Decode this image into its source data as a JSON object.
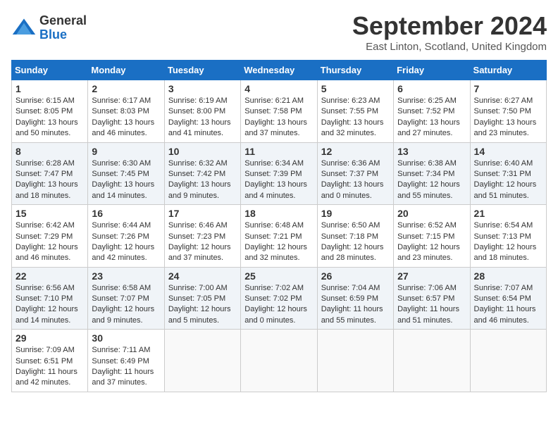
{
  "header": {
    "logo_general": "General",
    "logo_blue": "Blue",
    "title": "September 2024",
    "location": "East Linton, Scotland, United Kingdom"
  },
  "calendar": {
    "headers": [
      "Sunday",
      "Monday",
      "Tuesday",
      "Wednesday",
      "Thursday",
      "Friday",
      "Saturday"
    ],
    "weeks": [
      [
        {
          "day": "1",
          "sunrise": "6:15 AM",
          "sunset": "8:05 PM",
          "daylight": "13 hours and 50 minutes."
        },
        {
          "day": "2",
          "sunrise": "6:17 AM",
          "sunset": "8:03 PM",
          "daylight": "13 hours and 46 minutes."
        },
        {
          "day": "3",
          "sunrise": "6:19 AM",
          "sunset": "8:00 PM",
          "daylight": "13 hours and 41 minutes."
        },
        {
          "day": "4",
          "sunrise": "6:21 AM",
          "sunset": "7:58 PM",
          "daylight": "13 hours and 37 minutes."
        },
        {
          "day": "5",
          "sunrise": "6:23 AM",
          "sunset": "7:55 PM",
          "daylight": "13 hours and 32 minutes."
        },
        {
          "day": "6",
          "sunrise": "6:25 AM",
          "sunset": "7:52 PM",
          "daylight": "13 hours and 27 minutes."
        },
        {
          "day": "7",
          "sunrise": "6:27 AM",
          "sunset": "7:50 PM",
          "daylight": "13 hours and 23 minutes."
        }
      ],
      [
        {
          "day": "8",
          "sunrise": "6:28 AM",
          "sunset": "7:47 PM",
          "daylight": "13 hours and 18 minutes."
        },
        {
          "day": "9",
          "sunrise": "6:30 AM",
          "sunset": "7:45 PM",
          "daylight": "13 hours and 14 minutes."
        },
        {
          "day": "10",
          "sunrise": "6:32 AM",
          "sunset": "7:42 PM",
          "daylight": "13 hours and 9 minutes."
        },
        {
          "day": "11",
          "sunrise": "6:34 AM",
          "sunset": "7:39 PM",
          "daylight": "13 hours and 4 minutes."
        },
        {
          "day": "12",
          "sunrise": "6:36 AM",
          "sunset": "7:37 PM",
          "daylight": "13 hours and 0 minutes."
        },
        {
          "day": "13",
          "sunrise": "6:38 AM",
          "sunset": "7:34 PM",
          "daylight": "12 hours and 55 minutes."
        },
        {
          "day": "14",
          "sunrise": "6:40 AM",
          "sunset": "7:31 PM",
          "daylight": "12 hours and 51 minutes."
        }
      ],
      [
        {
          "day": "15",
          "sunrise": "6:42 AM",
          "sunset": "7:29 PM",
          "daylight": "12 hours and 46 minutes."
        },
        {
          "day": "16",
          "sunrise": "6:44 AM",
          "sunset": "7:26 PM",
          "daylight": "12 hours and 42 minutes."
        },
        {
          "day": "17",
          "sunrise": "6:46 AM",
          "sunset": "7:23 PM",
          "daylight": "12 hours and 37 minutes."
        },
        {
          "day": "18",
          "sunrise": "6:48 AM",
          "sunset": "7:21 PM",
          "daylight": "12 hours and 32 minutes."
        },
        {
          "day": "19",
          "sunrise": "6:50 AM",
          "sunset": "7:18 PM",
          "daylight": "12 hours and 28 minutes."
        },
        {
          "day": "20",
          "sunrise": "6:52 AM",
          "sunset": "7:15 PM",
          "daylight": "12 hours and 23 minutes."
        },
        {
          "day": "21",
          "sunrise": "6:54 AM",
          "sunset": "7:13 PM",
          "daylight": "12 hours and 18 minutes."
        }
      ],
      [
        {
          "day": "22",
          "sunrise": "6:56 AM",
          "sunset": "7:10 PM",
          "daylight": "12 hours and 14 minutes."
        },
        {
          "day": "23",
          "sunrise": "6:58 AM",
          "sunset": "7:07 PM",
          "daylight": "12 hours and 9 minutes."
        },
        {
          "day": "24",
          "sunrise": "7:00 AM",
          "sunset": "7:05 PM",
          "daylight": "12 hours and 5 minutes."
        },
        {
          "day": "25",
          "sunrise": "7:02 AM",
          "sunset": "7:02 PM",
          "daylight": "12 hours and 0 minutes."
        },
        {
          "day": "26",
          "sunrise": "7:04 AM",
          "sunset": "6:59 PM",
          "daylight": "11 hours and 55 minutes."
        },
        {
          "day": "27",
          "sunrise": "7:06 AM",
          "sunset": "6:57 PM",
          "daylight": "11 hours and 51 minutes."
        },
        {
          "day": "28",
          "sunrise": "7:07 AM",
          "sunset": "6:54 PM",
          "daylight": "11 hours and 46 minutes."
        }
      ],
      [
        {
          "day": "29",
          "sunrise": "7:09 AM",
          "sunset": "6:51 PM",
          "daylight": "11 hours and 42 minutes."
        },
        {
          "day": "30",
          "sunrise": "7:11 AM",
          "sunset": "6:49 PM",
          "daylight": "11 hours and 37 minutes."
        },
        null,
        null,
        null,
        null,
        null
      ]
    ]
  }
}
